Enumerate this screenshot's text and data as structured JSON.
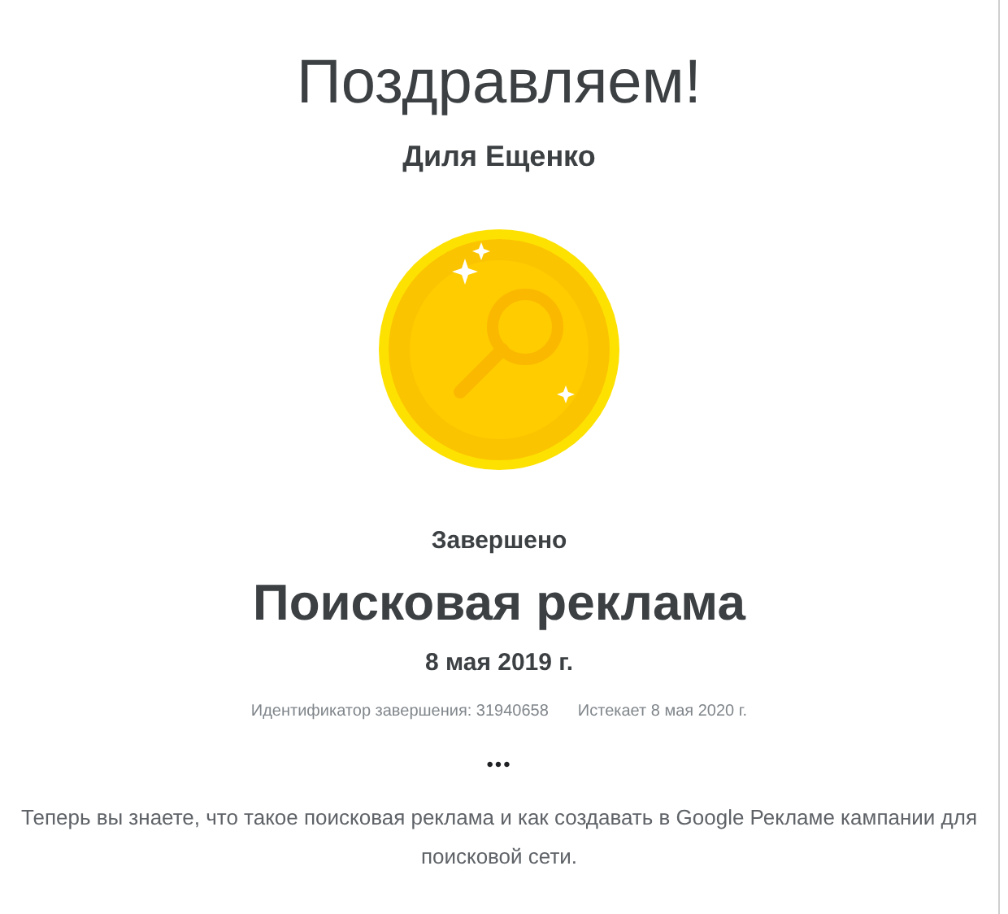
{
  "title": "Поздравляем!",
  "name": "Диля Ещенко",
  "status": "Завершено",
  "course": "Поисковая реклама",
  "date": "8 мая 2019 г.",
  "completion_id": "Идентификатор завершения: 31940658",
  "expires": "Истекает 8 мая 2020 г.",
  "more": "•••",
  "description": "Теперь вы знаете, что такое поисковая реклама и как создавать в Google Рекламе кампании для поисковой сети."
}
